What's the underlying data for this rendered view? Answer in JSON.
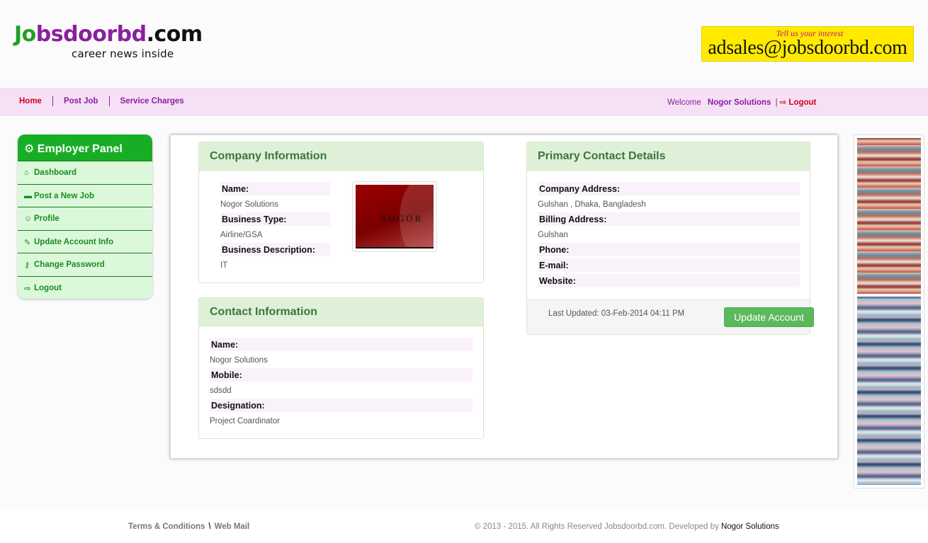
{
  "header": {
    "logo_main_j": "J",
    "logo_main_o": "o",
    "logo_main_rest": "bsdoorbd",
    "logo_main_dot": ".com",
    "logo_sub": "career news inside",
    "ad_top": "Tell us your interest",
    "ad_main": "adsales@jobsdoorbd.com"
  },
  "nav": {
    "items": [
      {
        "label": "Home"
      },
      {
        "label": "Post Job"
      },
      {
        "label": "Service Charges"
      }
    ],
    "welcome": "Welcome",
    "username": "Nogor Solutions",
    "separator": "|",
    "logout": "Logout"
  },
  "sidebar": {
    "title": "Employer Panel",
    "items": [
      {
        "label": "Dashboard",
        "icon": "home-icon"
      },
      {
        "label": "Post a New Job",
        "icon": "briefcase-icon"
      },
      {
        "label": "Profile",
        "icon": "smile-icon"
      },
      {
        "label": "Update Account Info",
        "icon": "edit-icon"
      },
      {
        "label": "Change Password",
        "icon": "key-icon"
      },
      {
        "label": "Logout",
        "icon": "sign-out-icon"
      }
    ]
  },
  "company": {
    "title": "Company Information",
    "name_label": "Name:",
    "name_value": "Nogor Solutions",
    "type_label": "Business Type:",
    "type_value": "Airline/GSA",
    "desc_label": "Business Description:",
    "desc_value": "IT",
    "logo_text": "NOGOR"
  },
  "contact": {
    "title": "Contact Information",
    "name_label": "Name:",
    "name_value": "Nogor Solutions",
    "mobile_label": "Mobile:",
    "mobile_value": "sdsdd",
    "designation_label": "Designation:",
    "designation_value": "Project Coardinator"
  },
  "primary": {
    "title": "Primary Contact Details",
    "address_label": "Company Address:",
    "address_value": "Gulshan , Dhaka, Bangladesh",
    "billing_label": "Billing Address:",
    "billing_value": "Gulshan",
    "phone_label": "Phone:",
    "email_label": "E-mail:",
    "website_label": "Website:",
    "last_updated": "Last Updated: 03-Feb-2014 04:11 PM",
    "update_button": "Update Account"
  },
  "footer": {
    "terms": "Terms & Conditions",
    "sep": "\\",
    "webmail": "Web Mail",
    "copyright": "© 2013 - 2015. All Rights Reserved Jobsdoorbd.com. Developed by",
    "developer": "Nogor Solutions"
  },
  "colors": {
    "brand_green": "#22a025",
    "brand_purple": "#8b1f9e",
    "nav_bg": "#f6e0f6",
    "sidebar_head": "#18ad25",
    "button_green": "#5cb85c",
    "ad_yellow": "#ffea00"
  }
}
